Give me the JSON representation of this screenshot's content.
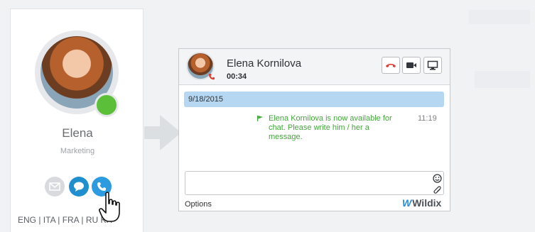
{
  "contact": {
    "name": "Elena",
    "department": "Marketing",
    "status_color": "#5cbf3a"
  },
  "actions": {
    "mail_icon": "envelope-icon",
    "chat_icon": "chat-bubble-icon",
    "call_icon": "phone-icon"
  },
  "languages": {
    "text": "ENG | ITA | FRA | RU   KR"
  },
  "chat": {
    "contact_name": "Elena Kornilova",
    "call_timer": "00:34",
    "date_label": "9/18/2015",
    "system_message": "Elena Kornilova is now available for chat. Please write him / her a message.",
    "message_time": "11:19",
    "options_label": "Options",
    "brand_name": "Wildix",
    "accent_color": "#b6d7f1",
    "message_color": "#43a63a",
    "hangup_color": "#e03a2f"
  }
}
